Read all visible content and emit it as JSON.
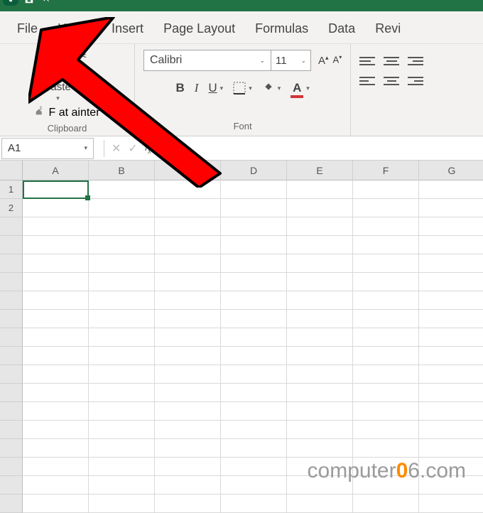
{
  "tabs": {
    "file": "File",
    "home": "Home",
    "insert": "Insert",
    "page_layout": "Page Layout",
    "formulas": "Formulas",
    "data": "Data",
    "review": "Revi"
  },
  "clipboard": {
    "paste": "Paste",
    "cut": "Cut",
    "copy_partial": "y ▾",
    "format_painter": "F    at  ainter",
    "group_label": "Clipboard"
  },
  "font": {
    "name": "Calibri",
    "size": "11",
    "bold": "B",
    "italic": "I",
    "underline": "U",
    "group_label": "Font",
    "fill_color": "#ffff00",
    "font_color": "#d13438"
  },
  "namebox": {
    "value": "A1"
  },
  "columns": [
    "A",
    "B",
    "C",
    "D",
    "E",
    "F",
    "G"
  ],
  "rows_start": 1,
  "watermark": {
    "brand": "computer",
    "zero": "0",
    "six": "6",
    "tld": ".com"
  }
}
